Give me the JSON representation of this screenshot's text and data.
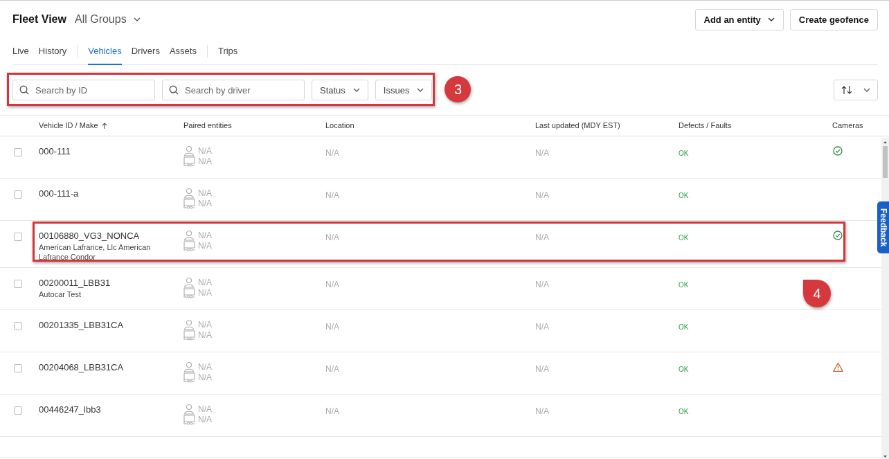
{
  "header": {
    "title": "Fleet View",
    "group_selector": "All Groups",
    "buttons": [
      {
        "label": "Add an entity",
        "kind": "dropdown"
      },
      {
        "label": "Create geofence",
        "kind": "plain"
      }
    ]
  },
  "tab_groups": [
    [
      {
        "label": "Live",
        "selected": false
      },
      {
        "label": "History",
        "selected": false
      }
    ],
    [
      {
        "label": "Vehicles",
        "selected": true
      },
      {
        "label": "Drivers",
        "selected": false
      },
      {
        "label": "Assets",
        "selected": false
      }
    ],
    [
      {
        "label": "Trips",
        "selected": false
      }
    ]
  ],
  "filters": [
    {
      "kind": "search",
      "placeholder": "Search by ID"
    },
    {
      "kind": "search",
      "placeholder": "Search by driver"
    },
    {
      "kind": "dropdown",
      "label": "Status"
    },
    {
      "kind": "dropdown",
      "label": "Issues"
    }
  ],
  "table": {
    "columns": [
      {
        "label": "Vehicle ID / Make",
        "sorted": true
      },
      {
        "label": "Paired entities",
        "sorted": false
      },
      {
        "label": "Location",
        "sorted": false
      },
      {
        "label": "Last updated (MDY EST)",
        "sorted": false
      },
      {
        "label": "Defects / Faults",
        "sorted": false
      },
      {
        "label": "Cameras",
        "sorted": false
      }
    ],
    "rows": [
      {
        "checked": false,
        "vehicle_id": "000-111",
        "driver": "N/A",
        "trailer": "N/A",
        "location": "N/A",
        "last_updated": "N/A",
        "defects": "OK",
        "camera_ok": true,
        "camera_warning": false
      },
      {
        "checked": false,
        "vehicle_id": "000-111-a",
        "driver": "N/A",
        "trailer": "N/A",
        "location": "N/A",
        "last_updated": "N/A",
        "defects": "OK",
        "camera_ok": false,
        "camera_warning": false
      },
      {
        "checked": false,
        "vehicle_id": "00106880_VG3_NONCA",
        "make": "American Lafrance, Llc American Lafrance Condor",
        "driver": "N/A",
        "trailer": "N/A",
        "location": "N/A",
        "last_updated": "N/A",
        "defects": "OK",
        "camera_ok": true,
        "camera_warning": false
      },
      {
        "checked": false,
        "vehicle_id": "00200011_LBB31",
        "make": "Autocar Test",
        "driver": "N/A",
        "trailer": "N/A",
        "location": "N/A",
        "last_updated": "N/A",
        "defects": "OK",
        "camera_ok": false,
        "camera_warning": false
      },
      {
        "checked": false,
        "vehicle_id": "00201335_LBB31CA",
        "driver": "N/A",
        "trailer": "N/A",
        "location": "N/A",
        "last_updated": "N/A",
        "defects": "OK",
        "camera_ok": false,
        "camera_warning": false
      },
      {
        "checked": false,
        "vehicle_id": "00204068_LBB31CA",
        "driver": "N/A",
        "trailer": "N/A",
        "location": "N/A",
        "last_updated": "N/A",
        "defects": "OK",
        "camera_ok": false,
        "camera_warning": true
      },
      {
        "checked": false,
        "vehicle_id": "00446247_lbb3",
        "driver": "N/A",
        "trailer": "N/A",
        "location": "N/A",
        "last_updated": "N/A",
        "defects": "OK",
        "camera_ok": false,
        "camera_warning": false
      }
    ]
  },
  "feedback_tab": {
    "label": "Feedback"
  },
  "annotations": [
    {
      "kind": "filters",
      "label": "3"
    },
    {
      "kind": "row",
      "label": "4"
    }
  ]
}
